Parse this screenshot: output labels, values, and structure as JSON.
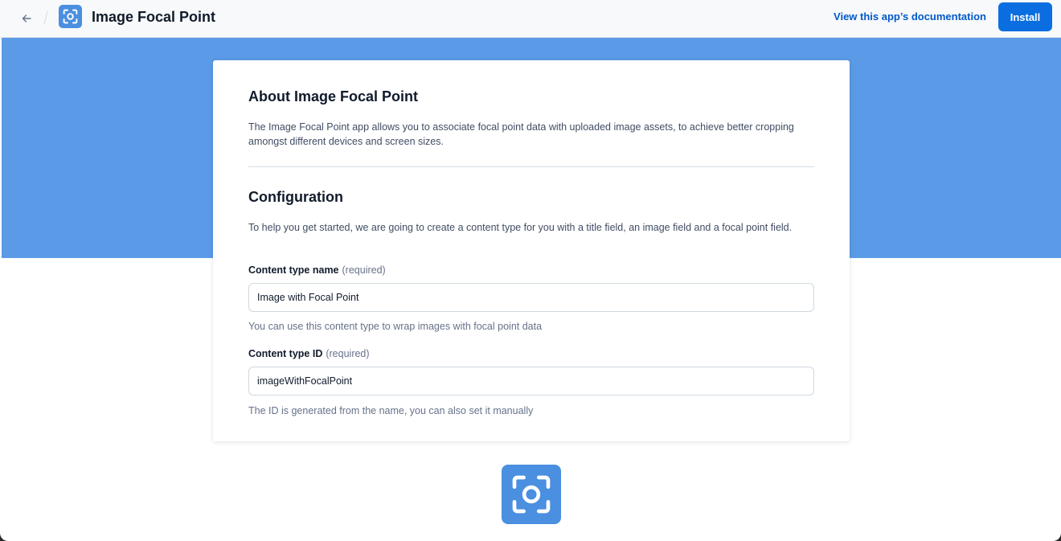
{
  "header": {
    "title": "Image Focal Point",
    "docs_link": "View this app’s documentation",
    "install_label": "Install",
    "back_icon": "arrow-left-icon",
    "app_icon": "focal-point-icon"
  },
  "colors": {
    "hero": "#5a9ae6",
    "primary": "#0a6ee1",
    "link": "#0059c8",
    "icon_bg": "#4a8fe0"
  },
  "card": {
    "about_heading": "About Image Focal Point",
    "about_text": "The Image Focal Point app allows you to associate focal point data with uploaded image assets, to achieve better cropping amongst different devices and screen sizes.",
    "config_heading": "Configuration",
    "config_text": "To help you get started, we are going to create a content type for you with a title field, an image field and a focal point field.",
    "name_field": {
      "label": "Content type name",
      "required": "(required)",
      "value": "Image with Focal Point",
      "help": "You can use this content type to wrap images with focal point data"
    },
    "id_field": {
      "label": "Content type ID",
      "required": "(required)",
      "value": "imageWithFocalPoint",
      "help": "The ID is generated from the name, you can also set it manually"
    }
  },
  "footer": {
    "app_icon": "focal-point-icon"
  }
}
